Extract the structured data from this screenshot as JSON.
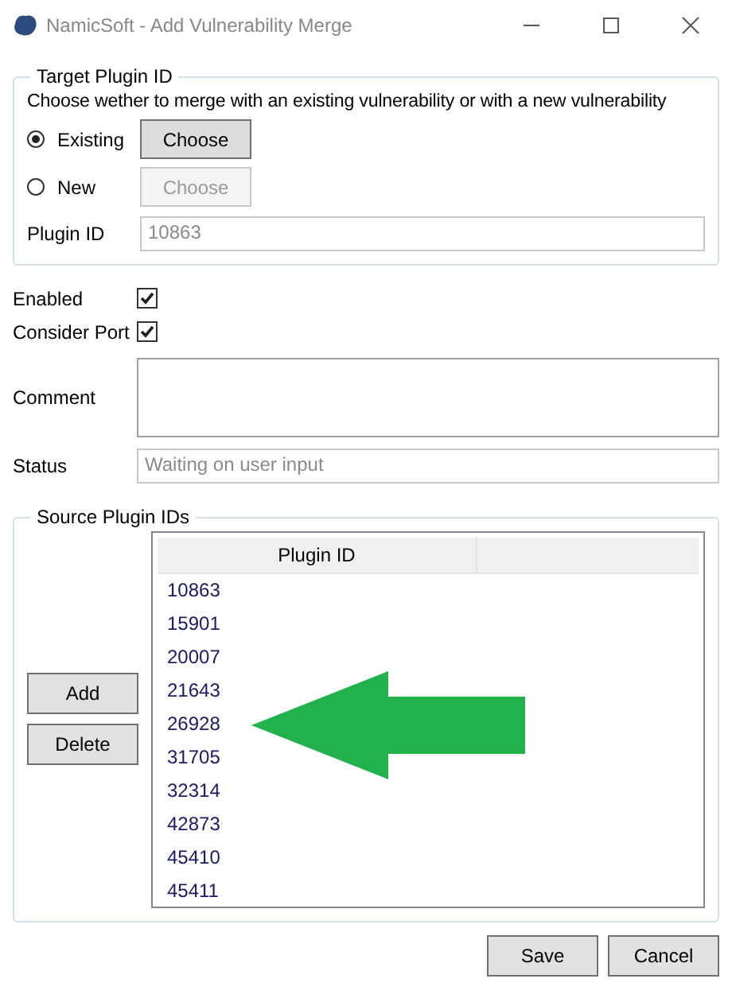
{
  "window": {
    "title": "NamicSoft - Add Vulnerability Merge"
  },
  "target_group": {
    "title": "Target Plugin ID",
    "instruction": "Choose wether to merge with an existing vulnerability or with a new vulnerability",
    "options": [
      {
        "label": "Existing",
        "selected": true,
        "button": "Choose",
        "disabled": false
      },
      {
        "label": "New",
        "selected": false,
        "button": "Choose",
        "disabled": true
      }
    ],
    "plugin_id_label": "Plugin ID",
    "plugin_id_value": "10863"
  },
  "checkboxes": [
    {
      "label": "Enabled",
      "checked": true
    },
    {
      "label": "Consider Port",
      "checked": true
    }
  ],
  "comment": {
    "label": "Comment"
  },
  "status": {
    "label": "Status",
    "value": "Waiting on user input"
  },
  "source_group": {
    "title": "Source Plugin IDs",
    "buttons": [
      "Add",
      "Delete"
    ],
    "columns": [
      "Plugin ID"
    ],
    "rows": [
      "10863",
      "15901",
      "20007",
      "21643",
      "26928",
      "31705",
      "32314",
      "42873",
      "45410",
      "45411"
    ]
  },
  "buttons": [
    "Save",
    "Cancel"
  ]
}
